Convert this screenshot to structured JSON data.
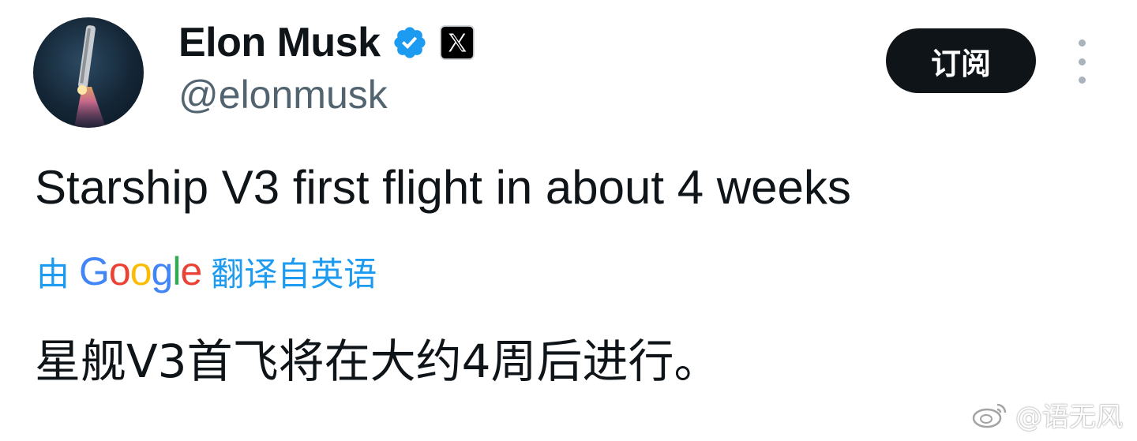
{
  "post": {
    "author": {
      "display_name": "Elon Musk",
      "handle": "@elonmusk",
      "verified_icon": "verified-badge-icon",
      "affiliation_icon": "x-logo-icon"
    },
    "follow_label": "订阅",
    "more_icon": "more-vertical-icon",
    "text": "Starship V3 first flight in about 4 weeks",
    "translation": {
      "prefix": "由",
      "provider": "Google",
      "suffix": "翻译自英语",
      "translated_text": "星舰V3首飞将在大约4周后进行。"
    }
  },
  "watermark": {
    "icon": "weibo-icon",
    "text": "@语无风"
  },
  "colors": {
    "text": "#0f1419",
    "secondary": "#536471",
    "link": "#1d9bf0",
    "button_bg": "#0f1419",
    "verified": "#1d9bf0"
  }
}
